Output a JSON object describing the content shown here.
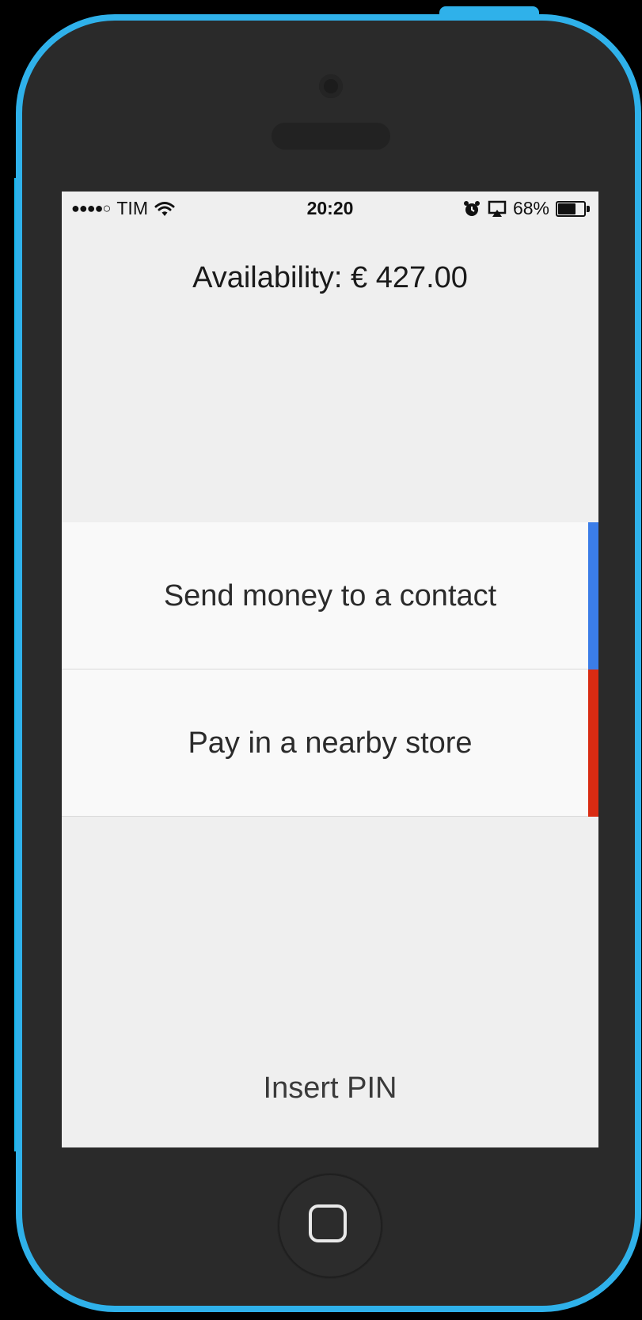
{
  "status_bar": {
    "signal": "●●●●○",
    "carrier": "TIM",
    "time": "20:20",
    "battery_percent": "68%",
    "battery_level": 0.68,
    "icons": [
      "wifi-icon",
      "alarm-icon",
      "airplay-icon",
      "battery-icon"
    ]
  },
  "availability": {
    "text": "Availability: € 427.00"
  },
  "actions": [
    {
      "label": "Send money to a contact",
      "accent_color": "#3b7de8"
    },
    {
      "label": "Pay in a nearby store",
      "accent_color": "#d92b12"
    }
  ],
  "footer": {
    "insert_pin_label": "Insert PIN"
  },
  "colors": {
    "phone_frame": "#2fb1ea",
    "phone_body": "#2a2a2a",
    "screen_background": "#efefef",
    "row_background": "#f9f9f9"
  },
  "hardware_icons": [
    "home-button",
    "front-camera",
    "earpiece"
  ]
}
